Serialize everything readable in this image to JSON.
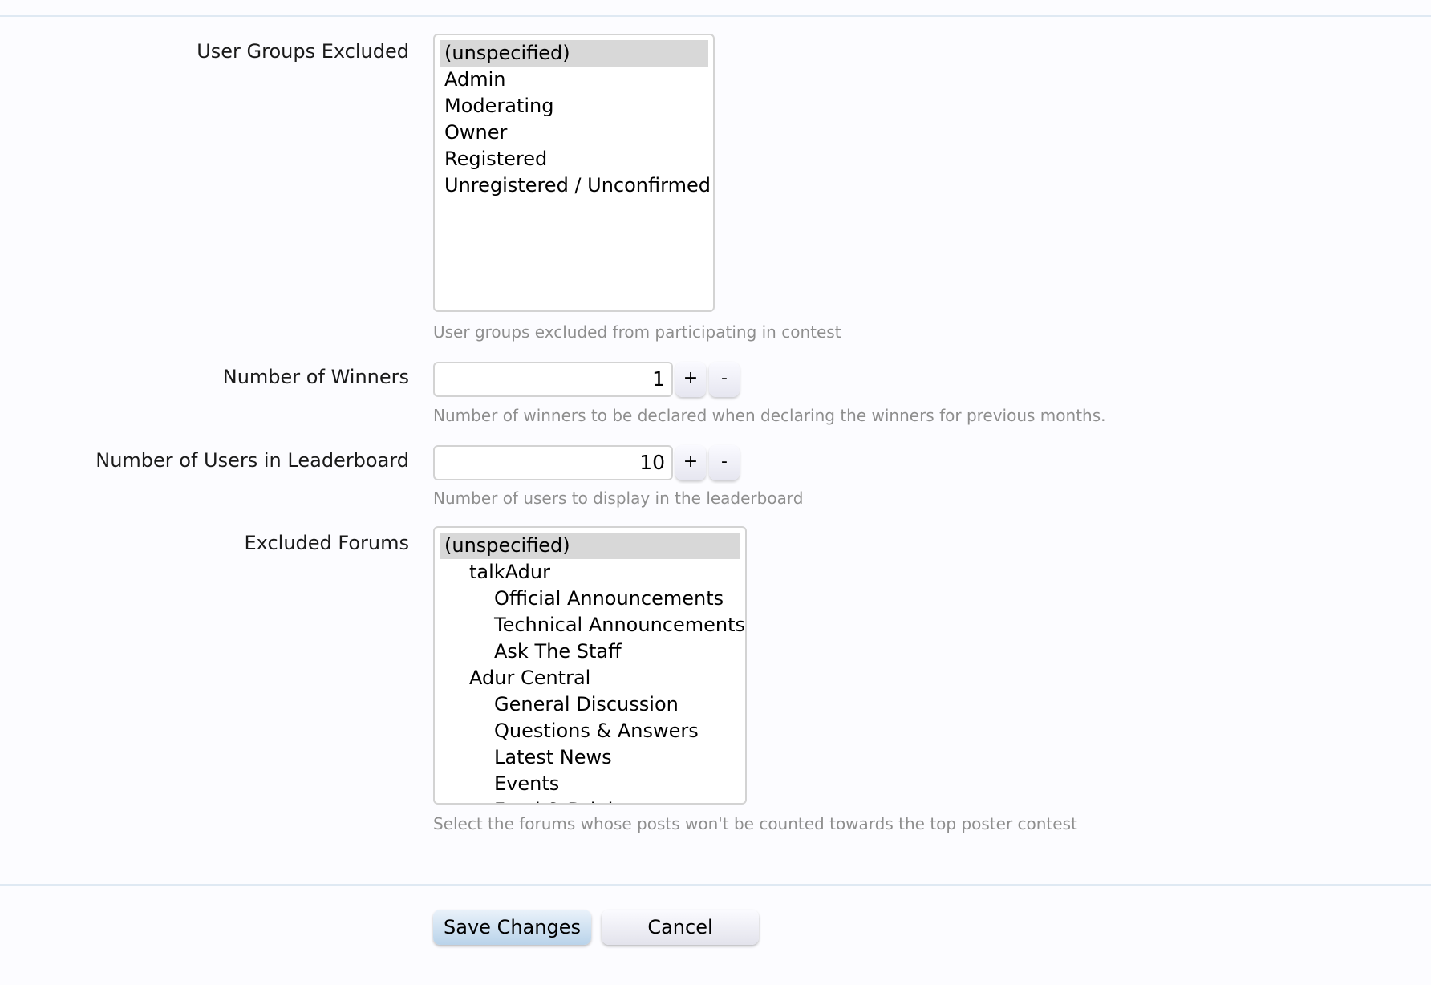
{
  "user_groups_excluded": {
    "label": "User Groups Excluded",
    "options": [
      {
        "label": "(unspecified)",
        "selected": true
      },
      {
        "label": "Admin",
        "selected": false
      },
      {
        "label": "Moderating",
        "selected": false
      },
      {
        "label": "Owner",
        "selected": false
      },
      {
        "label": "Registered",
        "selected": false
      },
      {
        "label": "Unregistered / Unconfirmed",
        "selected": false
      }
    ],
    "hint": "User groups excluded from participating in contest"
  },
  "number_of_winners": {
    "label": "Number of Winners",
    "value": "1",
    "plus": "+",
    "minus": "-",
    "hint": "Number of winners to be declared when declaring the winners for previous months."
  },
  "number_of_users": {
    "label": "Number of Users in Leaderboard",
    "value": "10",
    "plus": "+",
    "minus": "-",
    "hint": "Number of users to display in the leaderboard"
  },
  "excluded_forums": {
    "label": "Excluded Forums",
    "options": [
      {
        "label": "(unspecified)",
        "level": 0,
        "selected": true
      },
      {
        "label": "talkAdur",
        "level": 1,
        "selected": false
      },
      {
        "label": "Official Announcements",
        "level": 2,
        "selected": false
      },
      {
        "label": "Technical Announcements",
        "level": 2,
        "selected": false
      },
      {
        "label": "Ask The Staff",
        "level": 2,
        "selected": false
      },
      {
        "label": "Adur Central",
        "level": 1,
        "selected": false
      },
      {
        "label": "General Discussion",
        "level": 2,
        "selected": false
      },
      {
        "label": "Questions & Answers",
        "level": 2,
        "selected": false
      },
      {
        "label": "Latest News",
        "level": 2,
        "selected": false
      },
      {
        "label": "Events",
        "level": 2,
        "selected": false
      },
      {
        "label": "Food & Drink",
        "level": 2,
        "selected": false
      }
    ],
    "hint": "Select the forums whose posts won't be counted towards the top poster contest"
  },
  "actions": {
    "save": "Save Changes",
    "cancel": "Cancel"
  }
}
